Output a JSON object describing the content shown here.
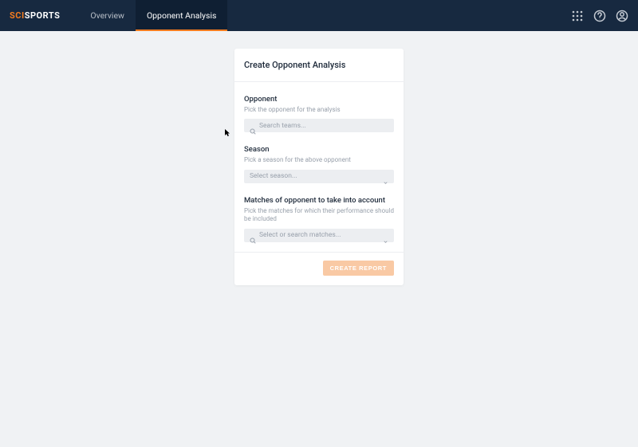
{
  "logo": {
    "part1": "SCI",
    "part2": "SPORTS"
  },
  "nav": {
    "tabs": [
      {
        "label": "Overview",
        "active": false
      },
      {
        "label": "Opponent Analysis",
        "active": true
      }
    ]
  },
  "card": {
    "title": "Create Opponent Analysis",
    "sections": {
      "opponent": {
        "label": "Opponent",
        "hint": "Pick the opponent for the analysis",
        "placeholder": "Search teams..."
      },
      "season": {
        "label": "Season",
        "hint": "Pick a season for the above opponent",
        "placeholder": "Select season..."
      },
      "matches": {
        "label": "Matches of opponent to take into account",
        "hint": "Pick the matches for which their performance should be included",
        "placeholder": "Select or search matches..."
      }
    },
    "button": "CREATE REPORT"
  }
}
